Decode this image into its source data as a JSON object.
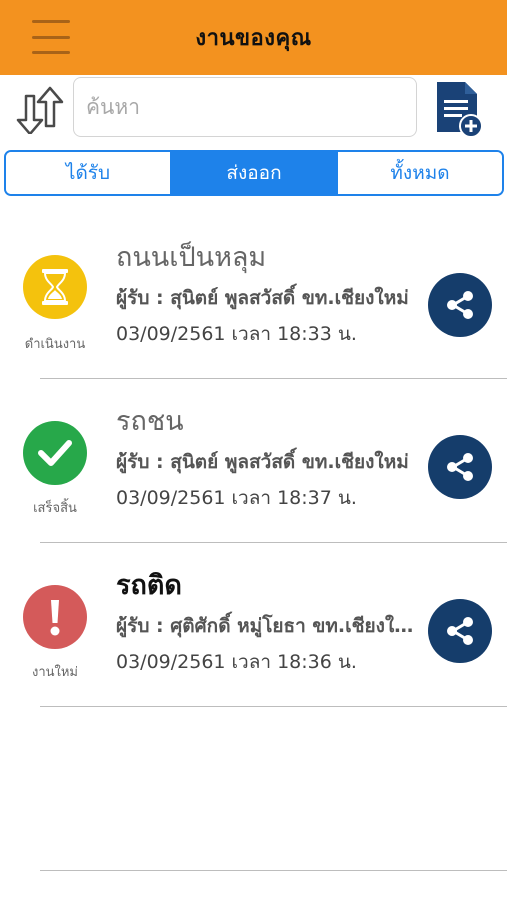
{
  "header": {
    "title": "งานของคุณ",
    "menu_icon": "hamburger-menu-icon",
    "background": "#f3921f"
  },
  "toolbar": {
    "sort_icon": "sort-arrows-icon",
    "search_placeholder": "ค้นหา",
    "search_value": "",
    "new_doc_icon": "document-add-icon"
  },
  "tabs": [
    {
      "label": "ได้รับ",
      "active": false
    },
    {
      "label": "ส่งออก",
      "active": true
    },
    {
      "label": "ทั้งหมด",
      "active": false
    }
  ],
  "items": [
    {
      "status": "ดำเนินงาน",
      "status_icon": "hourglass-icon",
      "status_color": "#f4c20d",
      "title": "ถนนเป็นหลุม",
      "recipient": "ผู้รับ : สุนิตย์ พูลสวัสดิ์ ขท.เชียงใหม่",
      "datetime": "03/09/2561 เวลา 18:33 น.",
      "share_icon": "share-icon"
    },
    {
      "status": "เสร็จสิ้น",
      "status_icon": "checkmark-icon",
      "status_color": "#27a84a",
      "title": "รถชน",
      "recipient": "ผู้รับ : สุนิตย์ พูลสวัสดิ์ ขท.เชียงใหม่",
      "datetime": "03/09/2561 เวลา 18:37 น.",
      "share_icon": "share-icon"
    },
    {
      "status": "งานใหม่",
      "status_icon": "exclamation-icon",
      "status_color": "#d45a5a",
      "title": "รถติด",
      "recipient": "ผู้รับ : ศุติศักดิ์ หมู่โยธา ขท.เชียงใหม่",
      "datetime": "03/09/2561 เวลา 18:36 น.",
      "share_icon": "share-icon"
    }
  ]
}
